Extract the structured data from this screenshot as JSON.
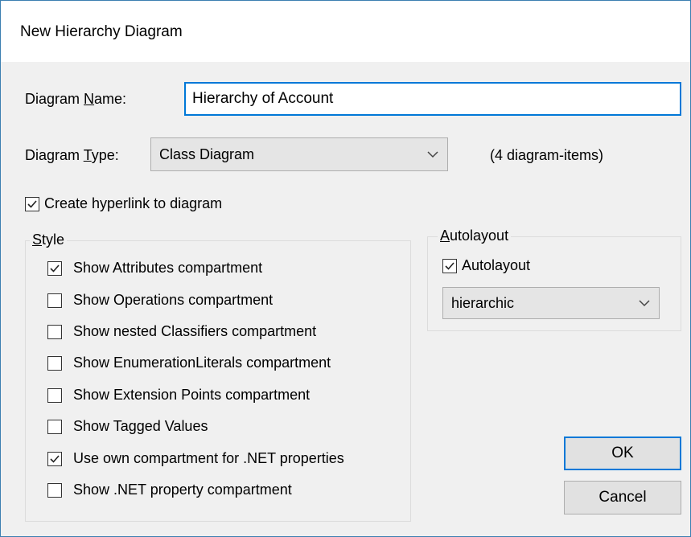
{
  "window": {
    "title": "New Hierarchy Diagram"
  },
  "diagram_name": {
    "label_prefix": "Diagram ",
    "label_mnemonic": "N",
    "label_suffix": "ame:",
    "value": "Hierarchy of Account"
  },
  "diagram_type": {
    "label_prefix": "Diagram ",
    "label_mnemonic": "T",
    "label_suffix": "ype:",
    "selected": "Class Diagram",
    "item_count": "(4 diagram-items)"
  },
  "create_hyperlink": {
    "label": "Create hyperlink to diagram",
    "checked": true
  },
  "style": {
    "legend_mnemonic": "S",
    "legend_rest": "tyle",
    "options": [
      {
        "label": "Show Attributes compartment",
        "checked": true
      },
      {
        "label": "Show Operations compartment",
        "checked": false
      },
      {
        "label": "Show nested Classifiers compartment",
        "checked": false
      },
      {
        "label": "Show EnumerationLiterals compartment",
        "checked": false
      },
      {
        "label": "Show Extension Points compartment",
        "checked": false
      },
      {
        "label": "Show Tagged Values",
        "checked": false
      },
      {
        "label": "Use own compartment for .NET properties",
        "checked": true
      },
      {
        "label": "Show .NET property compartment",
        "checked": false
      }
    ]
  },
  "autolayout": {
    "legend_mnemonic": "A",
    "legend_rest": "utolayout",
    "checkbox_label": "Autolayout",
    "checked": true,
    "selected": "hierarchic"
  },
  "buttons": {
    "ok": "OK",
    "cancel": "Cancel"
  },
  "colors": {
    "accent": "#0078d7",
    "dialog_bg": "#f0f0f0"
  }
}
